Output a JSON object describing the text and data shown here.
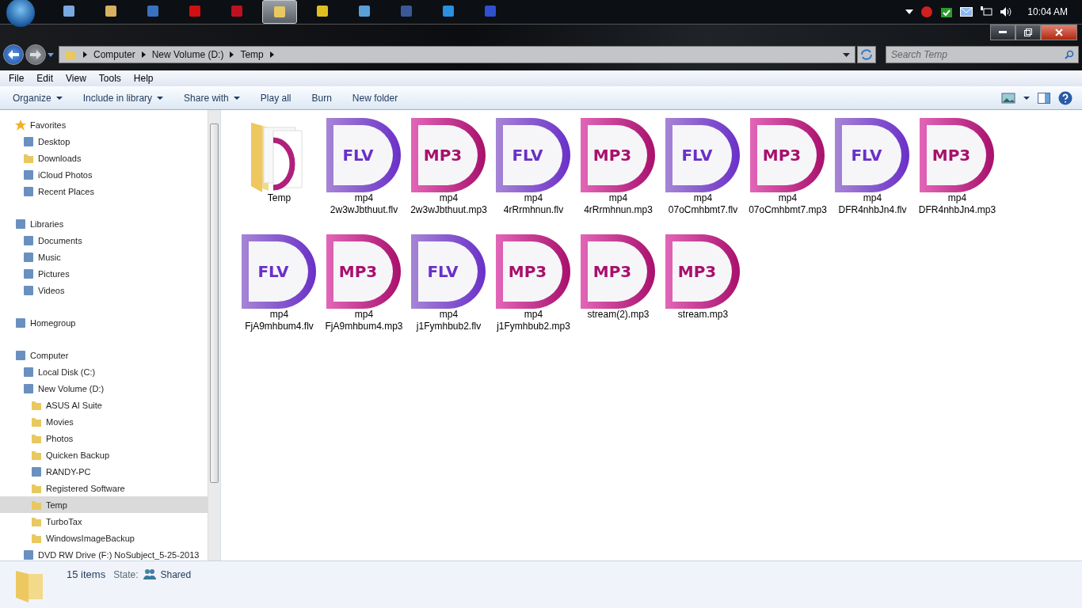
{
  "taskbar": {
    "apps": [
      {
        "selected": false
      },
      {
        "selected": false
      },
      {
        "selected": false
      },
      {
        "selected": false
      },
      {
        "selected": false
      },
      {
        "selected": true
      },
      {
        "selected": false
      },
      {
        "selected": false
      },
      {
        "selected": false
      },
      {
        "selected": false
      },
      {
        "selected": false
      }
    ],
    "clock": "10:04 AM"
  },
  "address": {
    "crumbs": [
      "Computer",
      "New Volume (D:)",
      "Temp"
    ],
    "search_placeholder": "Search Temp"
  },
  "menu": [
    "File",
    "Edit",
    "View",
    "Tools",
    "Help"
  ],
  "toolbar": [
    "Organize",
    "Include in library",
    "Share with",
    "Play all",
    "Burn",
    "New folder"
  ],
  "sidebar": [
    {
      "label": "Favorites",
      "kind": "star",
      "selected": false,
      "children": [
        {
          "label": "Desktop",
          "kind": "item",
          "selected": false
        },
        {
          "label": "Downloads",
          "kind": "folder",
          "selected": false
        },
        {
          "label": "iCloud Photos",
          "kind": "item",
          "selected": false
        },
        {
          "label": "Recent Places",
          "kind": "item",
          "selected": false
        }
      ]
    },
    {
      "label": "Libraries",
      "kind": "item",
      "selected": false,
      "children": [
        {
          "label": "Documents",
          "kind": "item",
          "selected": false
        },
        {
          "label": "Music",
          "kind": "item",
          "selected": false
        },
        {
          "label": "Pictures",
          "kind": "item",
          "selected": false
        },
        {
          "label": "Videos",
          "kind": "item",
          "selected": false
        }
      ]
    },
    {
      "label": "Homegroup",
      "kind": "item",
      "selected": false
    },
    {
      "label": "Computer",
      "kind": "item",
      "selected": false,
      "children": [
        {
          "label": "Local Disk (C:)",
          "kind": "item",
          "selected": false
        },
        {
          "label": "New Volume (D:)",
          "kind": "item",
          "selected": false,
          "children": [
            {
              "label": "ASUS AI Suite",
              "kind": "folder",
              "selected": false
            },
            {
              "label": "Movies",
              "kind": "folder",
              "selected": false
            },
            {
              "label": "Photos",
              "kind": "folder",
              "selected": false
            },
            {
              "label": "Quicken Backup",
              "kind": "folder",
              "selected": false
            },
            {
              "label": "RANDY-PC",
              "kind": "item",
              "selected": false
            },
            {
              "label": "Registered Software",
              "kind": "folder",
              "selected": false
            },
            {
              "label": "Temp",
              "kind": "folder",
              "selected": true
            },
            {
              "label": "TurboTax",
              "kind": "folder",
              "selected": false
            },
            {
              "label": "WindowsImageBackup",
              "kind": "folder",
              "selected": false
            }
          ]
        },
        {
          "label": "DVD RW Drive (F:) NoSubject_5-25-2013",
          "kind": "item",
          "selected": false
        }
      ]
    }
  ],
  "files": [
    {
      "kind": "folder",
      "name": "Temp"
    },
    {
      "kind": "flv",
      "badge": "FLV",
      "name": "mp4 2w3wJbthuut.flv"
    },
    {
      "kind": "mp3",
      "badge": "MP3",
      "name": "mp4 2w3wJbthuut.mp3"
    },
    {
      "kind": "flv",
      "badge": "FLV",
      "name": "mp4 4rRrmhnun.flv"
    },
    {
      "kind": "mp3",
      "badge": "MP3",
      "name": "mp4 4rRrmhnun.mp3"
    },
    {
      "kind": "flv",
      "badge": "FLV",
      "name": "mp4 07oCmhbmt7.flv"
    },
    {
      "kind": "mp3",
      "badge": "MP3",
      "name": "mp4 07oCmhbmt7.mp3"
    },
    {
      "kind": "flv",
      "badge": "FLV",
      "name": "mp4 DFR4nhbJn4.flv"
    },
    {
      "kind": "mp3",
      "badge": "MP3",
      "name": "mp4 DFR4nhbJn4.mp3"
    },
    {
      "kind": "flv",
      "badge": "FLV",
      "name": "mp4 FjA9mhbum4.flv"
    },
    {
      "kind": "mp3",
      "badge": "MP3",
      "name": "mp4 FjA9mhbum4.mp3"
    },
    {
      "kind": "flv",
      "badge": "FLV",
      "name": "mp4 j1Fymhbub2.flv"
    },
    {
      "kind": "mp3",
      "badge": "MP3",
      "name": "mp4 j1Fymhbub2.mp3"
    },
    {
      "kind": "mp3",
      "badge": "MP3",
      "name": "stream(2).mp3"
    },
    {
      "kind": "mp3",
      "badge": "MP3",
      "name": "stream.mp3"
    }
  ],
  "status": {
    "count": "15 items",
    "state_label": "State:",
    "state": "Shared"
  }
}
